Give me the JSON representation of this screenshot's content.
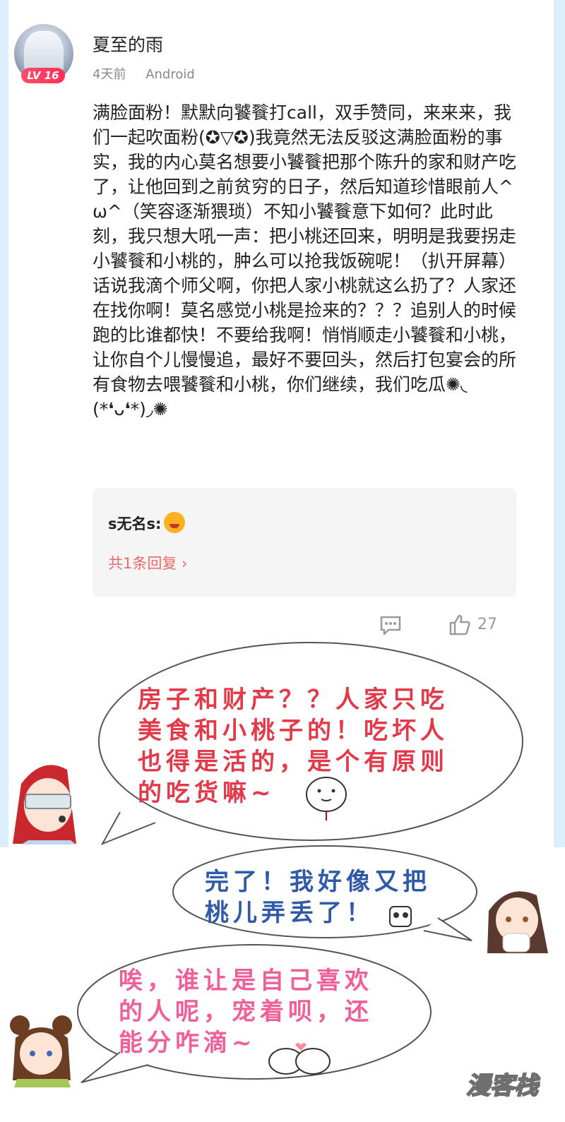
{
  "post": {
    "username": "夏至的雨",
    "level": "LV 16",
    "time": "4天前",
    "device": "Android",
    "content": "满脸面粉！默默向饕餮打call，双手赞同，来来来，我们一起吹面粉(✪▽✪)我竟然无法反驳这满脸面粉的事实，我的内心莫名想要小饕餮把那个陈升的家和财产吃了，让他回到之前贫穷的日子，然后知道珍惜眼前人^ω^（笑容逐渐猥琐）不知小饕餮意下如何？此时此刻，我只想大吼一声：把小桃还回来，明明是我要拐走小饕餮和小桃的，肿么可以抢我饭碗呢！（扒开屏幕）话说我滴个师父啊，你把人家小桃就这么扔了？人家还在找你啊！莫名感觉小桃是捡来的？？？追别人的时候跑的比谁都快！不要给我啊！悄悄顺走小饕餮和小桃，让你自个儿慢慢追，最好不要回头，然后打包宴会的所有食物去喂饕餮和小桃，你们继续，我们吃瓜✺◟(*❛ᴗ❛*)◞✺"
  },
  "reply": {
    "author": "s无名s:",
    "count_text": "共1条回复 ›"
  },
  "actions": {
    "like_count": "27"
  },
  "comic": {
    "bubble1_lines": [
      "房子和财产？？人家只吃",
      "美食和小桃子的！吃坏人",
      "也得是活的，是个有原则",
      "的吃货嘛~"
    ],
    "bubble2_lines": [
      "完了！我好像又把",
      "桃儿弄丢了！"
    ],
    "bubble3_lines": [
      "唉，谁让是自己喜欢",
      "的人呢，宠着呗，还",
      "能分咋滴~"
    ],
    "colors": {
      "bubble1": "#e23a4a",
      "bubble2": "#2f5aa8",
      "bubble3": "#ef5f9a"
    }
  },
  "watermark": "漫客栈"
}
